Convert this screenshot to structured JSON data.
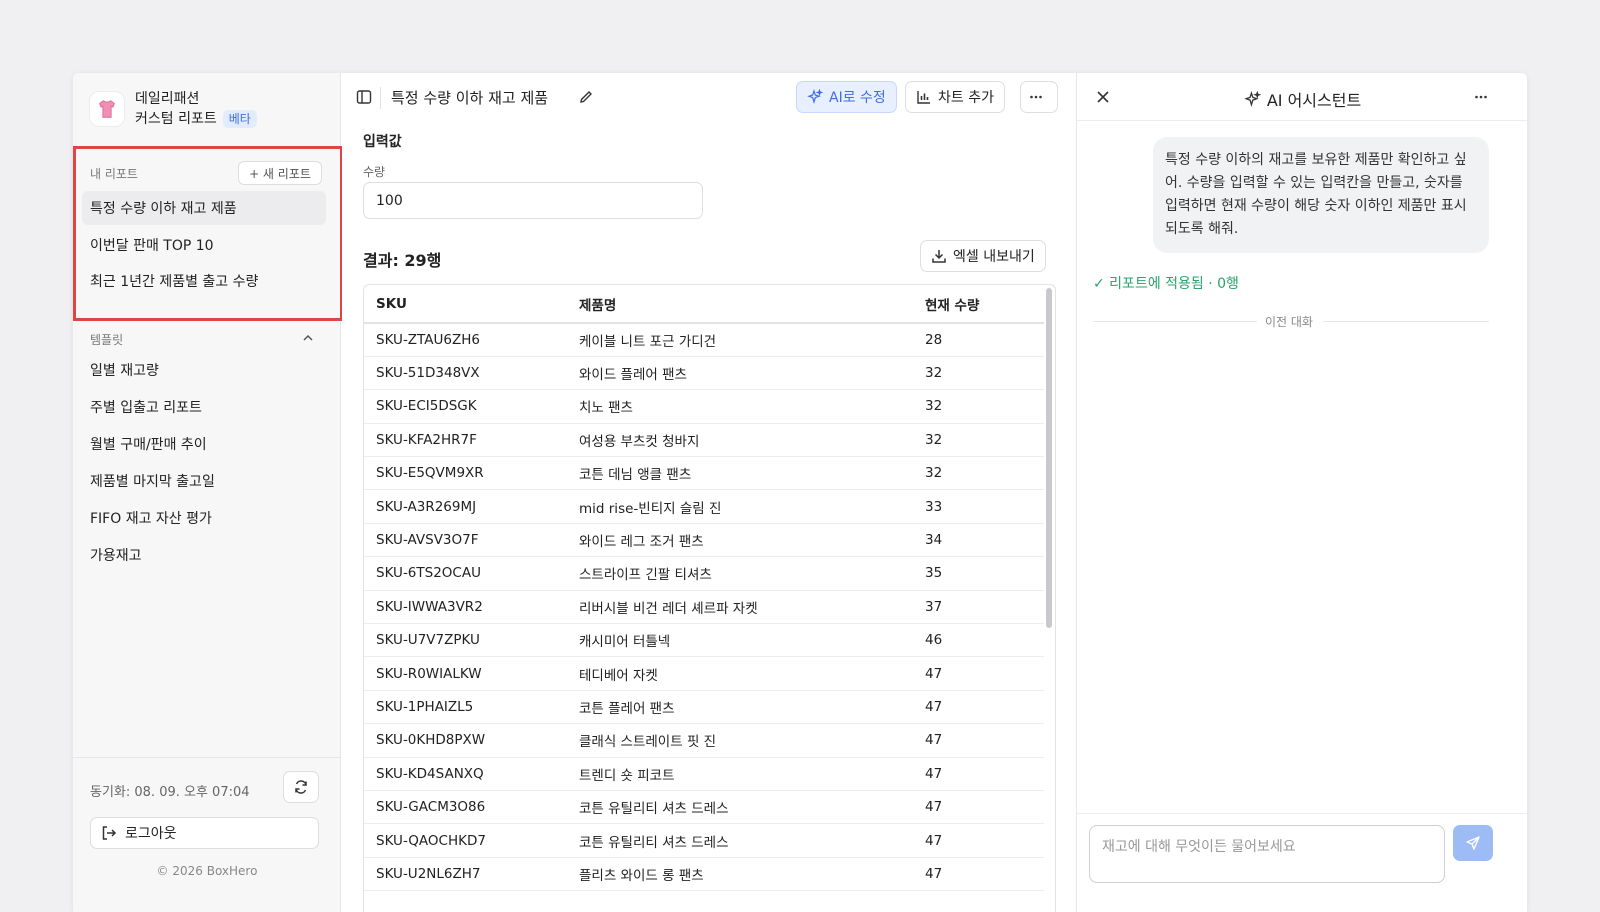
{
  "brand": {
    "line1": "데일리패션",
    "line2": "커스텀 리포트",
    "badge": "베타"
  },
  "my_reports": {
    "heading": "내 리포트",
    "new_button": "+ 새 리포트",
    "items": [
      "특정 수량 이하 재고 제품",
      "이번달 판매 TOP 10",
      "최근 1년간 제품별 출고 수량"
    ]
  },
  "templates": {
    "heading": "템플릿",
    "items": [
      "일별 재고량",
      "주별 입출고 리포트",
      "월별 구매/판매 추이",
      "제품별 마지막 출고일",
      "FIFO 재고 자산 평가",
      "가용재고"
    ]
  },
  "footer": {
    "sync": "동기화: 08. 09. 오후 07:04",
    "logout": "로그아웃",
    "copyright": "© 2026 BoxHero"
  },
  "main": {
    "title": "특정 수량 이하 재고 제품",
    "ai_edit": "AI로 수정",
    "add_chart": "차트 추가",
    "input_section": "입력값",
    "quantity_label": "수량",
    "quantity_value": "100",
    "result_title": "결과: 29행",
    "export": "엑셀 내보내기"
  },
  "table": {
    "headers": [
      "SKU",
      "제품명",
      "현재 수량"
    ],
    "rows": [
      [
        "SKU-ZTAU6ZH6",
        "케이블 니트 포근 가디건",
        "28"
      ],
      [
        "SKU-51D348VX",
        "와이드 플레어 팬츠",
        "32"
      ],
      [
        "SKU-ECI5DSGK",
        "치노 팬츠",
        "32"
      ],
      [
        "SKU-KFA2HR7F",
        "여성용 부츠컷 청바지",
        "32"
      ],
      [
        "SKU-E5QVM9XR",
        "코튼 데님 앵클 팬츠",
        "32"
      ],
      [
        "SKU-A3R269MJ",
        "mid rise-빈티지 슬림 진",
        "33"
      ],
      [
        "SKU-AVSV3O7F",
        "와이드 레그 조거 팬츠",
        "34"
      ],
      [
        "SKU-6TS2OCAU",
        "스트라이프 긴팔 티셔츠",
        "35"
      ],
      [
        "SKU-IWWA3VR2",
        "리버시블 비건 레더 셰르파 자켓",
        "37"
      ],
      [
        "SKU-U7V7ZPKU",
        "캐시미어 터틀넥",
        "46"
      ],
      [
        "SKU-R0WIALKW",
        "테디베어 자켓",
        "47"
      ],
      [
        "SKU-1PHAIZL5",
        "코튼 플레어 팬츠",
        "47"
      ],
      [
        "SKU-0KHD8PXW",
        "클래식 스트레이트 핏 진",
        "47"
      ],
      [
        "SKU-KD4SANXQ",
        "트렌디 숏 피코트",
        "47"
      ],
      [
        "SKU-GACM3O86",
        "코튼 유틸리티 셔츠 드레스",
        "47"
      ],
      [
        "SKU-QAOCHKD7",
        "코튼 유틸리티 셔츠 드레스",
        "47"
      ],
      [
        "SKU-U2NL6ZH7",
        "플리츠 와이드 롱 팬츠",
        "47"
      ]
    ]
  },
  "assistant": {
    "title": "AI 어시스턴트",
    "message": "특정 수량 이하의 재고를 보유한 제품만 확인하고 싶어. 수량을 입력할 수 있는 입력칸을 만들고, 숫자를 입력하면 현재 수량이 해당 숫자 이하인 제품만 표시되도록 해줘.",
    "applied": "✓ 리포트에 적용됨 · 0행",
    "divider": "이전 대화",
    "placeholder": "재고에 대해 무엇이든 물어보세요"
  },
  "colors": {
    "accent": "#3f6fe0",
    "success": "#27a56a",
    "highlight": "#e04545"
  }
}
